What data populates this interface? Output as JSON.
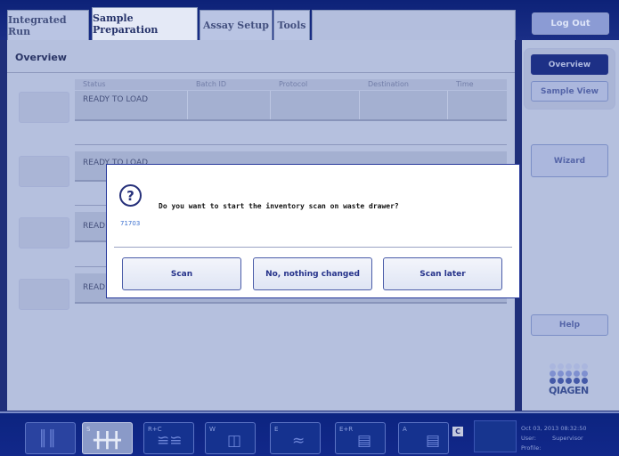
{
  "tabs": [
    {
      "label": "Integrated Run"
    },
    {
      "label": "Sample Preparation"
    },
    {
      "label": "Assay Setup"
    },
    {
      "label": "Tools"
    }
  ],
  "header": {
    "logout_label": "Log Out"
  },
  "overview": {
    "title": "Overview",
    "columns": [
      "Status",
      "Batch ID",
      "Protocol",
      "Destination",
      "Time"
    ],
    "rows": [
      {
        "status": "READY TO LOAD"
      },
      {
        "status": "READY TO LOAD"
      },
      {
        "status": "READ"
      },
      {
        "status": "READ"
      }
    ]
  },
  "right_panel": {
    "overview_label": "Overview",
    "sample_view_label": "Sample View",
    "wizard_label": "Wizard",
    "help_label": "Help",
    "logo_text": "QIAGEN"
  },
  "dialog": {
    "icon": "question-icon",
    "message": "Do you want to start the inventory scan on waste drawer?",
    "code": "71703",
    "buttons": {
      "scan": "Scan",
      "no_change": "No, nothing changed",
      "scan_later": "Scan later"
    }
  },
  "bottom_bar": {
    "slots": [
      {
        "label": "",
        "icon": "rack-icon"
      },
      {
        "label": "S",
        "icon": "tube-rack-icon"
      },
      {
        "label": "R+C",
        "icon": "reagent-cartridge-icon"
      },
      {
        "label": "W",
        "icon": "waste-bin-icon"
      },
      {
        "label": "E",
        "icon": "eluate-icon"
      },
      {
        "label": "E+R",
        "icon": "eluate-reagent-icon"
      },
      {
        "label": "A",
        "icon": "assay-icon"
      }
    ],
    "drawer_badge": "C",
    "datetime": "Oct 03, 2013 08:32:50",
    "user_key": "User:",
    "user_value": "Supervisor",
    "profile_key": "Profile:"
  },
  "colors": {
    "top_bar": "#0d2278",
    "active_button": "#1d3086",
    "dialog_border": "#27399b",
    "code_text": "#3b6fcf"
  }
}
